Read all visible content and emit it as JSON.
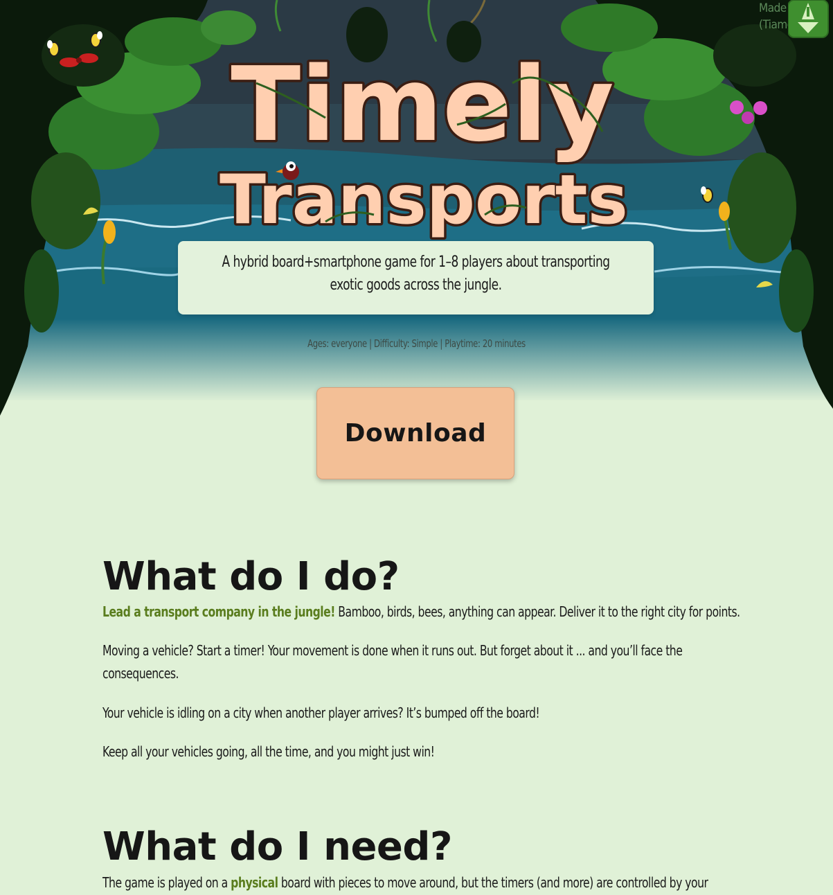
{
  "hero": {
    "title_line1": "Timely",
    "title_line2": "Transports",
    "credit_line1": "Made b",
    "credit_line2": "(Tiamo",
    "tagline_line1": "A hybrid board+smartphone game for 1–8 players about transporting",
    "tagline_line2": "exotic goods across the jungle.",
    "stats": "Ages: everyone | Difficulty: Simple | Playtime: 20 minutes",
    "download_label": "Download"
  },
  "sections": [
    {
      "heading": "What do I do?",
      "p1_highlight": "Lead a transport company in the jungle!",
      "p1_rest": " Bamboo, birds, bees, anything can appear. Deliver it to the right city for points.",
      "p2_line1": "Moving a vehicle? Start a timer! Your movement is done when it runs out. But forget about it ... and you’ll face the",
      "p2_line2": "consequences.",
      "p3": "Your vehicle is idling on a city when another player arrives? It’s bumped off the board!",
      "p4": "Keep all your vehicles going, all the time, and you might just win!"
    },
    {
      "heading": "What do I need?",
      "p1_start": "The game is played on a ",
      "p1_link": "physical",
      "p1_end": " board with pieces to move around, but the timers (and more) are controlled by your"
    }
  ],
  "colors": {
    "background": "#e0f1d7",
    "accent_green": "#5a7d1e",
    "button": "#f3bf96",
    "title_fill": "#ffcfb0",
    "title_outline": "#3b1d12"
  },
  "icons": [
    "logo-badge-icon",
    "bee-icon",
    "butterfly-icon",
    "bird-icon",
    "flower-icon"
  ]
}
